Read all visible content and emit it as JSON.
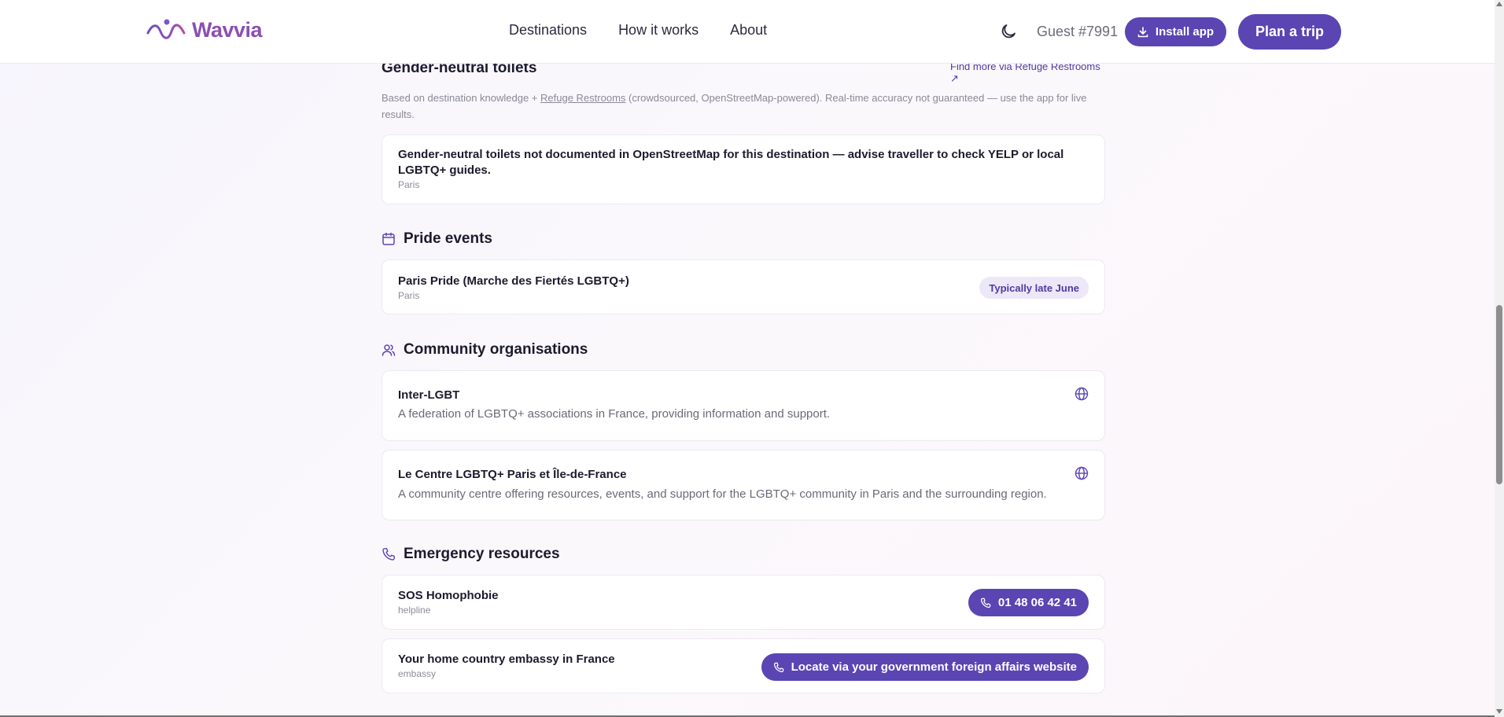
{
  "header": {
    "logo_text": "Wavvia",
    "nav": [
      "Destinations",
      "How it works",
      "About"
    ],
    "guest": "Guest #7991",
    "install_label": "Install app",
    "plan_label": "Plan a trip"
  },
  "toilets": {
    "title": "Gender-neutral toilets",
    "link": "Find more via Refuge Restrooms ↗",
    "note_prefix": "Based on destination knowledge + ",
    "note_link": "Refuge Restrooms",
    "note_suffix": " (crowdsourced, OpenStreetMap-powered). Real-time accuracy not guaranteed — use the app for live results.",
    "card_title": "Gender-neutral toilets not documented in OpenStreetMap for this destination — advise traveller to check YELP or local LGBTQ+ guides.",
    "card_sub": "Paris"
  },
  "pride": {
    "title": "Pride events",
    "events": [
      {
        "name": "Paris Pride (Marche des Fiertés LGBTQ+)",
        "location": "Paris",
        "date": "Typically late June"
      }
    ]
  },
  "community": {
    "title": "Community organisations",
    "orgs": [
      {
        "name": "Inter-LGBT",
        "description": "A federation of LGBTQ+ associations in France, providing information and support."
      },
      {
        "name": "Le Centre LGBTQ+ Paris et Île-de-France",
        "description": "A community centre offering resources, events, and support for the LGBTQ+ community in Paris and the surrounding region."
      }
    ]
  },
  "emergency": {
    "title": "Emergency resources",
    "items": [
      {
        "name": "SOS Homophobie",
        "type": "helpline",
        "action": "01 48 06 42 41"
      },
      {
        "name": "Your home country embassy in France",
        "type": "embassy",
        "action": "Locate via your government foreign affairs website"
      }
    ]
  },
  "colors": {
    "accent": "#5a45b3",
    "brand": "#8a4fb0",
    "pill_light": "#ece8f8"
  },
  "icons": {
    "theme": "moon-icon",
    "install": "download-icon",
    "pride": "calendar-icon",
    "community": "users-icon",
    "emergency": "phone-icon",
    "website": "globe-icon"
  }
}
